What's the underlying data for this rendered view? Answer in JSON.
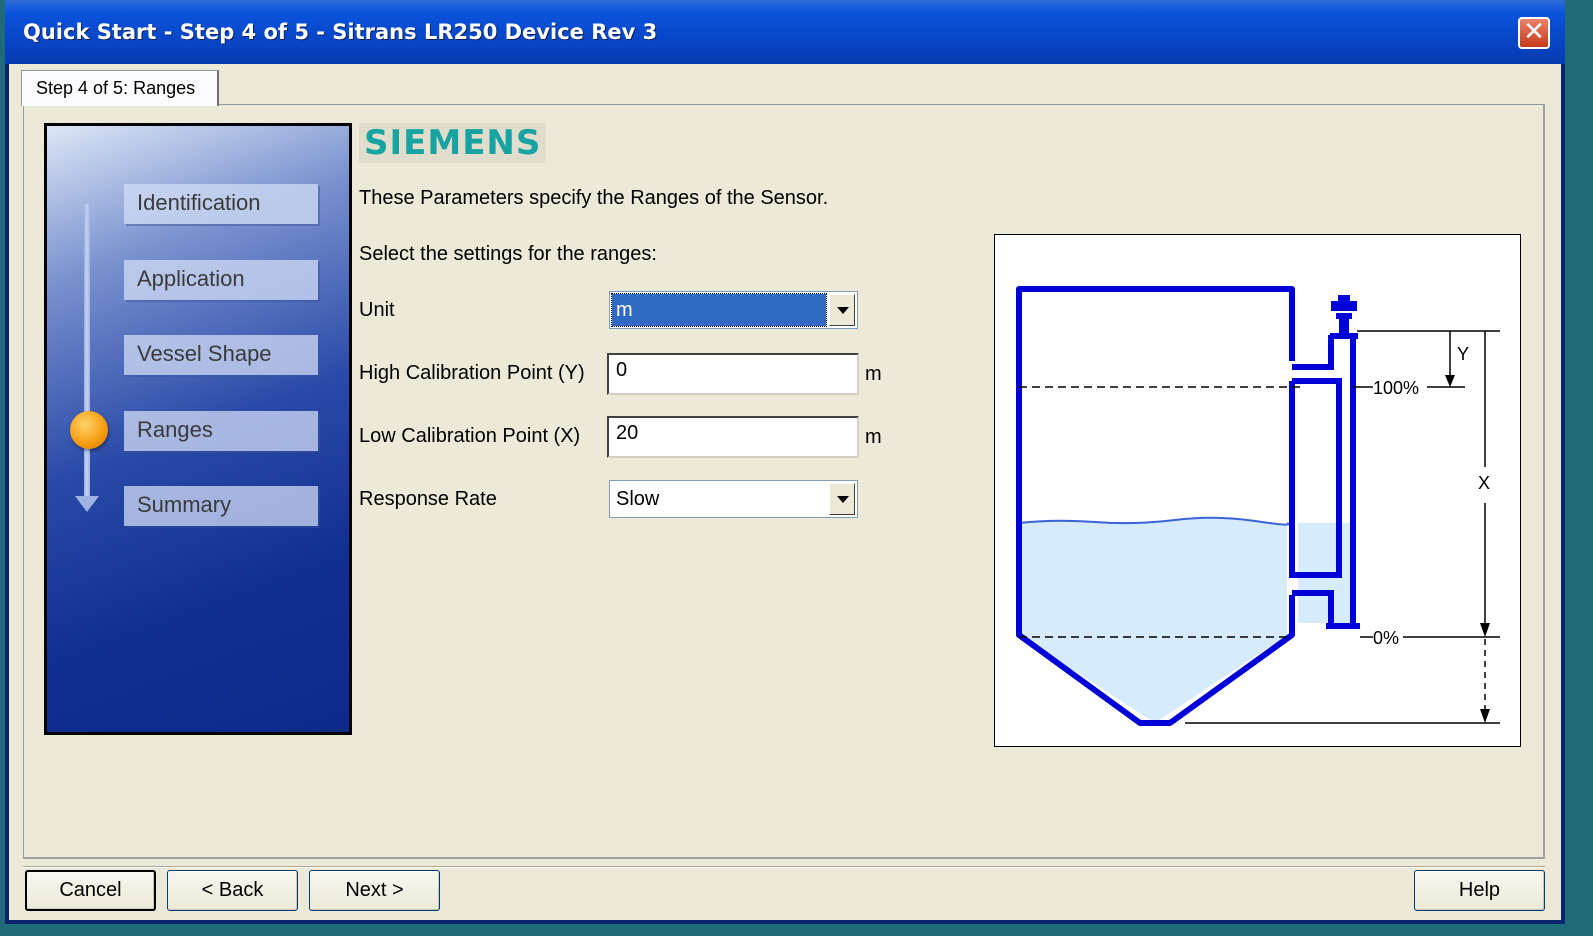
{
  "window": {
    "title": "Quick Start - Step 4 of 5 - Sitrans LR250 Device Rev 3",
    "close_label": "✕"
  },
  "tab": {
    "label": "Step 4 of 5: Ranges"
  },
  "steps": [
    {
      "label": "Identification",
      "active": false
    },
    {
      "label": "Application",
      "active": false
    },
    {
      "label": "Vessel Shape",
      "active": false
    },
    {
      "label": "Ranges",
      "active": true
    },
    {
      "label": "Summary",
      "active": false
    }
  ],
  "brand": {
    "logo_text": "SIEMENS",
    "color": "#16a3a1"
  },
  "content": {
    "intro": "These Parameters specify the Ranges of the Sensor.",
    "instruction": "Select the settings for the ranges:"
  },
  "form": {
    "unit": {
      "label": "Unit",
      "value": "m"
    },
    "high_cal": {
      "label": "High Calibration Point (Y)",
      "value": "0",
      "unit": "m"
    },
    "low_cal": {
      "label": "Low Calibration Point (X)",
      "value": "20",
      "unit": "m"
    },
    "response_rate": {
      "label": "Response Rate",
      "value": "Slow"
    }
  },
  "diagram": {
    "label_100": "100%",
    "label_0": "0%",
    "label_y": "Y",
    "label_x": "X",
    "vessel_color": "#0000d8",
    "liquid_color": "#d6ebfb"
  },
  "buttons": {
    "cancel": "Cancel",
    "back": "< Back",
    "next": "Next >",
    "help": "Help"
  }
}
